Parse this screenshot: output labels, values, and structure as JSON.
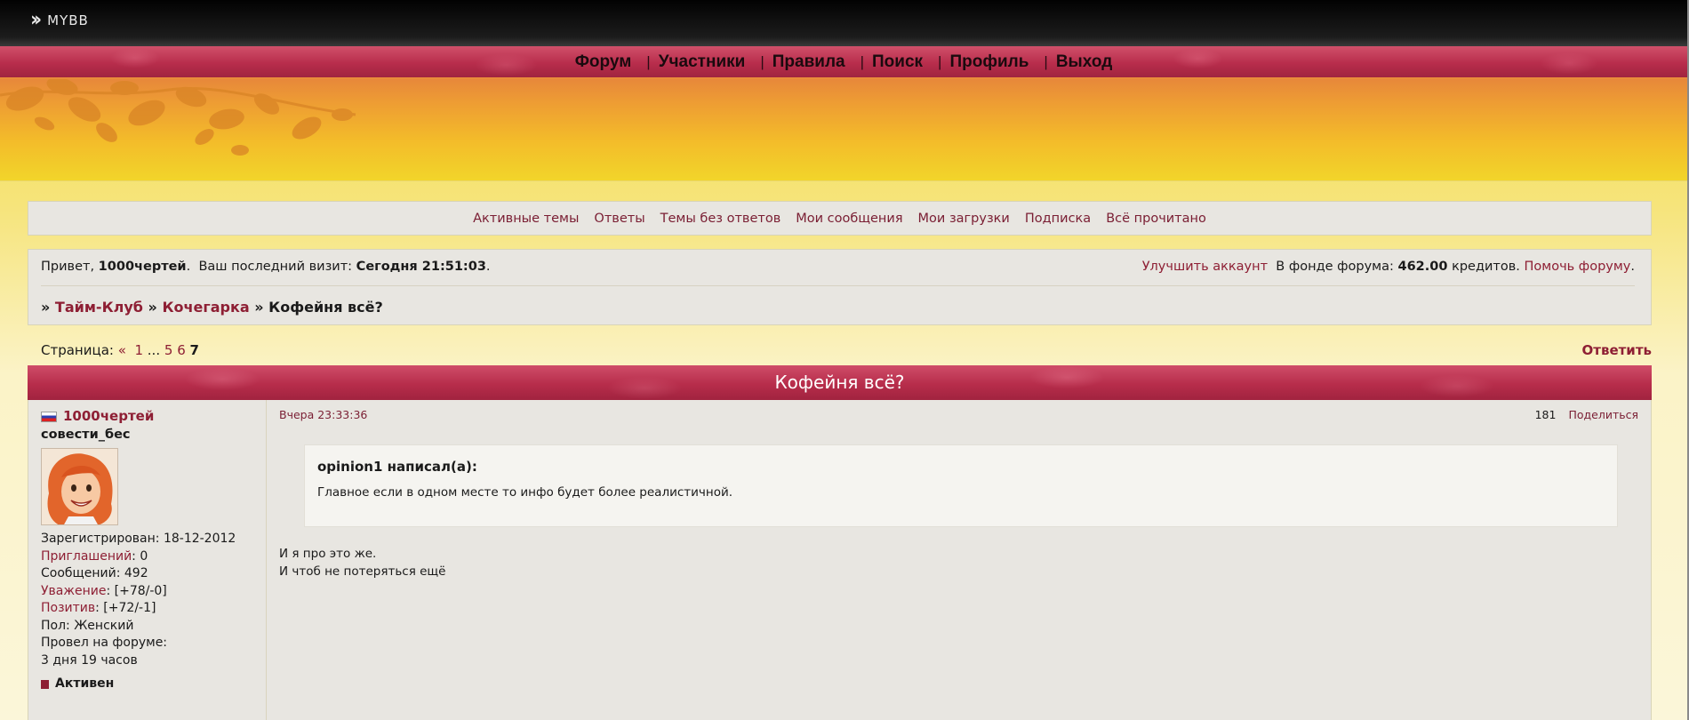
{
  "brand": {
    "logo_text": "MYBB"
  },
  "nav": {
    "items": [
      {
        "label": "Форум"
      },
      {
        "label": "Участники"
      },
      {
        "label": "Правила"
      },
      {
        "label": "Поиск"
      },
      {
        "label": "Профиль"
      },
      {
        "label": "Выход"
      }
    ],
    "separator": "|"
  },
  "quicklinks": [
    "Активные темы",
    "Ответы",
    "Темы без ответов",
    "Мои сообщения",
    "Мои загрузки",
    "Подписка",
    "Всё прочитано"
  ],
  "userinfo": {
    "greeting": "Привет,",
    "username": "1000чертей",
    "last_visit_label": "Ваш последний визит:",
    "last_visit_value": "Сегодня 21:51:03",
    "upgrade_link": "Улучшить аккаунт",
    "fund_label": "В фонде форума:",
    "fund_value": "462.00",
    "fund_unit": "кредитов.",
    "help_link": "Помочь форуму"
  },
  "breadcrumb": {
    "items": [
      "Тайм-Клуб",
      "Кочегарка"
    ],
    "current": "Кофейня всё?",
    "separator": "»"
  },
  "pagination": {
    "label": "Страница:",
    "prev": "«",
    "pages": [
      "1",
      "5",
      "6"
    ],
    "ellipsis": "...",
    "current": "7"
  },
  "reply_label": "Ответить",
  "topic": {
    "title": "Кофейня всё?"
  },
  "post": {
    "author": {
      "name": "1000чертей",
      "title": "совести_бес",
      "registered_label": "Зарегистрирован:",
      "registered_value": "18-12-2012",
      "invites_label": "Приглашений",
      "invites_value": ": 0",
      "messages_label": "Сообщений:",
      "messages_value": "492",
      "respect_label": "Уважение",
      "respect_value": ": [+78/-0]",
      "positive_label": "Позитив",
      "positive_value": ": [+72/-1]",
      "gender_label": "Пол:",
      "gender_value": "Женский",
      "online_label": "Провел на форуме:",
      "online_value": "3 дня 19 часов",
      "status": "Активен",
      "status_color": "#8e1f34"
    },
    "date": "Вчера 23:33:36",
    "number": "181",
    "share_label": "Поделиться",
    "quote": {
      "author_line": "opinion1 написал(а):",
      "text": "Главное если в одном месте то инфо будет более реалистичной."
    },
    "lines": [
      "И я про это же.",
      "И чтоб не потеряться ещё"
    ]
  },
  "colors": {
    "accent": "#8e1f34",
    "navbar": "#b82d4c",
    "banner_top": "#e7883a",
    "banner_bottom": "#f2d52a",
    "panel": "#e8e6e1"
  }
}
